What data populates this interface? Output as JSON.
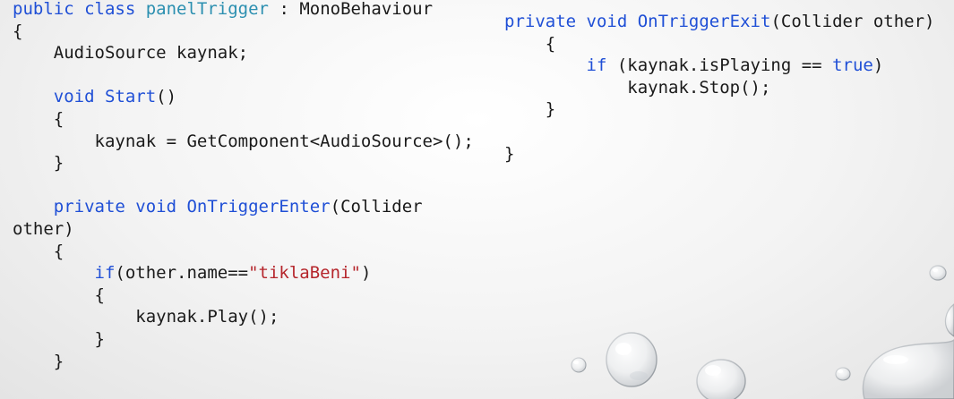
{
  "left_code": [
    [
      {
        "t": "public class ",
        "c": "kw"
      },
      {
        "t": "panelTrigger",
        "c": "type"
      },
      {
        "t": " : MonoBehaviour",
        "c": "plain"
      }
    ],
    [
      {
        "t": "{",
        "c": "plain"
      }
    ],
    [
      {
        "t": "    AudioSource kaynak;",
        "c": "plain"
      }
    ],
    [],
    [
      {
        "t": "    void ",
        "c": "kw"
      },
      {
        "t": "Start",
        "c": "kw"
      },
      {
        "t": "()",
        "c": "plain"
      }
    ],
    [
      {
        "t": "    {",
        "c": "plain"
      }
    ],
    [
      {
        "t": "        kaynak = GetComponent<AudioSource>();",
        "c": "plain"
      }
    ],
    [
      {
        "t": "    }",
        "c": "plain"
      }
    ],
    [],
    [
      {
        "t": "    private void ",
        "c": "kw"
      },
      {
        "t": "OnTriggerEnter",
        "c": "kw"
      },
      {
        "t": "(Collider",
        "c": "plain"
      }
    ],
    [
      {
        "t": "other)",
        "c": "plain"
      }
    ],
    [
      {
        "t": "    {",
        "c": "plain"
      }
    ],
    [
      {
        "t": "        if",
        "c": "kw"
      },
      {
        "t": "(other.name==",
        "c": "plain"
      },
      {
        "t": "\"tiklaBeni\"",
        "c": "str"
      },
      {
        "t": ")",
        "c": "plain"
      }
    ],
    [
      {
        "t": "        {",
        "c": "plain"
      }
    ],
    [
      {
        "t": "            kaynak.Play();",
        "c": "plain"
      }
    ],
    [
      {
        "t": "        }",
        "c": "plain"
      }
    ],
    [
      {
        "t": "    }",
        "c": "plain"
      }
    ]
  ],
  "right_code": [
    [
      {
        "t": "private void ",
        "c": "kw"
      },
      {
        "t": "OnTriggerExit",
        "c": "kw"
      },
      {
        "t": "(Collider other)",
        "c": "plain"
      }
    ],
    [
      {
        "t": "    {",
        "c": "plain"
      }
    ],
    [
      {
        "t": "        if ",
        "c": "kw"
      },
      {
        "t": "(kaynak.isPlaying == ",
        "c": "plain"
      },
      {
        "t": "true",
        "c": "kw"
      },
      {
        "t": ")",
        "c": "plain"
      }
    ],
    [
      {
        "t": "            kaynak.Stop();",
        "c": "plain"
      }
    ],
    [
      {
        "t": "    }",
        "c": "plain"
      }
    ],
    [],
    [
      {
        "t": "}",
        "c": "plain"
      }
    ]
  ],
  "colors": {
    "keyword": "#1f4fd6",
    "type": "#2b8fb0",
    "string": "#b5252b",
    "text": "#1a1a1a"
  },
  "decoration": {
    "theme": "water-droplets",
    "icon": "water-droplet-icon"
  }
}
